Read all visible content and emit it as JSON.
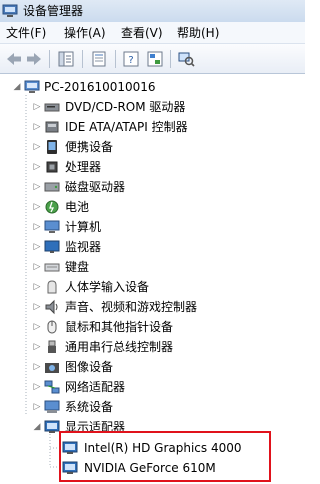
{
  "window": {
    "title": "设备管理器"
  },
  "menu": [
    {
      "label": "文件(F)"
    },
    {
      "label": "操作(A)"
    },
    {
      "label": "查看(V)"
    },
    {
      "label": "帮助(H)"
    }
  ],
  "toolbar": {
    "buttons": [
      {
        "icon": "back-arrow-icon"
      },
      {
        "icon": "forward-arrow-icon"
      },
      {
        "icon": "show-hide-console-tree-icon"
      },
      {
        "icon": "properties-icon"
      },
      {
        "icon": "help-icon"
      },
      {
        "icon": "devices-view-icon"
      }
    ]
  },
  "tree": {
    "root": {
      "label": "PC-201610010016",
      "icon": "computer-icon"
    },
    "categories": [
      {
        "label": "DVD/CD-ROM 驱动器",
        "icon": "dvd-drive-icon",
        "expanded": false
      },
      {
        "label": "IDE ATA/ATAPI 控制器",
        "icon": "ide-controller-icon",
        "expanded": false
      },
      {
        "label": "便携设备",
        "icon": "portable-device-icon",
        "expanded": false
      },
      {
        "label": "处理器",
        "icon": "processor-icon",
        "expanded": false
      },
      {
        "label": "磁盘驱动器",
        "icon": "disk-drive-icon",
        "expanded": false
      },
      {
        "label": "电池",
        "icon": "battery-icon",
        "expanded": false
      },
      {
        "label": "计算机",
        "icon": "computer-icon",
        "expanded": false
      },
      {
        "label": "监视器",
        "icon": "monitor-icon",
        "expanded": false
      },
      {
        "label": "键盘",
        "icon": "keyboard-icon",
        "expanded": false
      },
      {
        "label": "人体学输入设备",
        "icon": "hid-icon",
        "expanded": false
      },
      {
        "label": "声音、视频和游戏控制器",
        "icon": "sound-icon",
        "expanded": false
      },
      {
        "label": "鼠标和其他指针设备",
        "icon": "mouse-icon",
        "expanded": false
      },
      {
        "label": "通用串行总线控制器",
        "icon": "usb-icon",
        "expanded": false
      },
      {
        "label": "图像设备",
        "icon": "imaging-device-icon",
        "expanded": false
      },
      {
        "label": "网络适配器",
        "icon": "network-adapter-icon",
        "expanded": false
      },
      {
        "label": "系统设备",
        "icon": "system-device-icon",
        "expanded": false
      },
      {
        "label": "显示适配器",
        "icon": "display-adapter-icon",
        "expanded": true
      }
    ],
    "display_adapters": [
      {
        "label": "Intel(R) HD Graphics 4000",
        "icon": "display-adapter-icon"
      },
      {
        "label": "NVIDIA GeForce 610M",
        "icon": "display-adapter-icon"
      }
    ]
  },
  "colors": {
    "highlight_border": "#e0121b",
    "titlebar": "#d6e3f3"
  }
}
